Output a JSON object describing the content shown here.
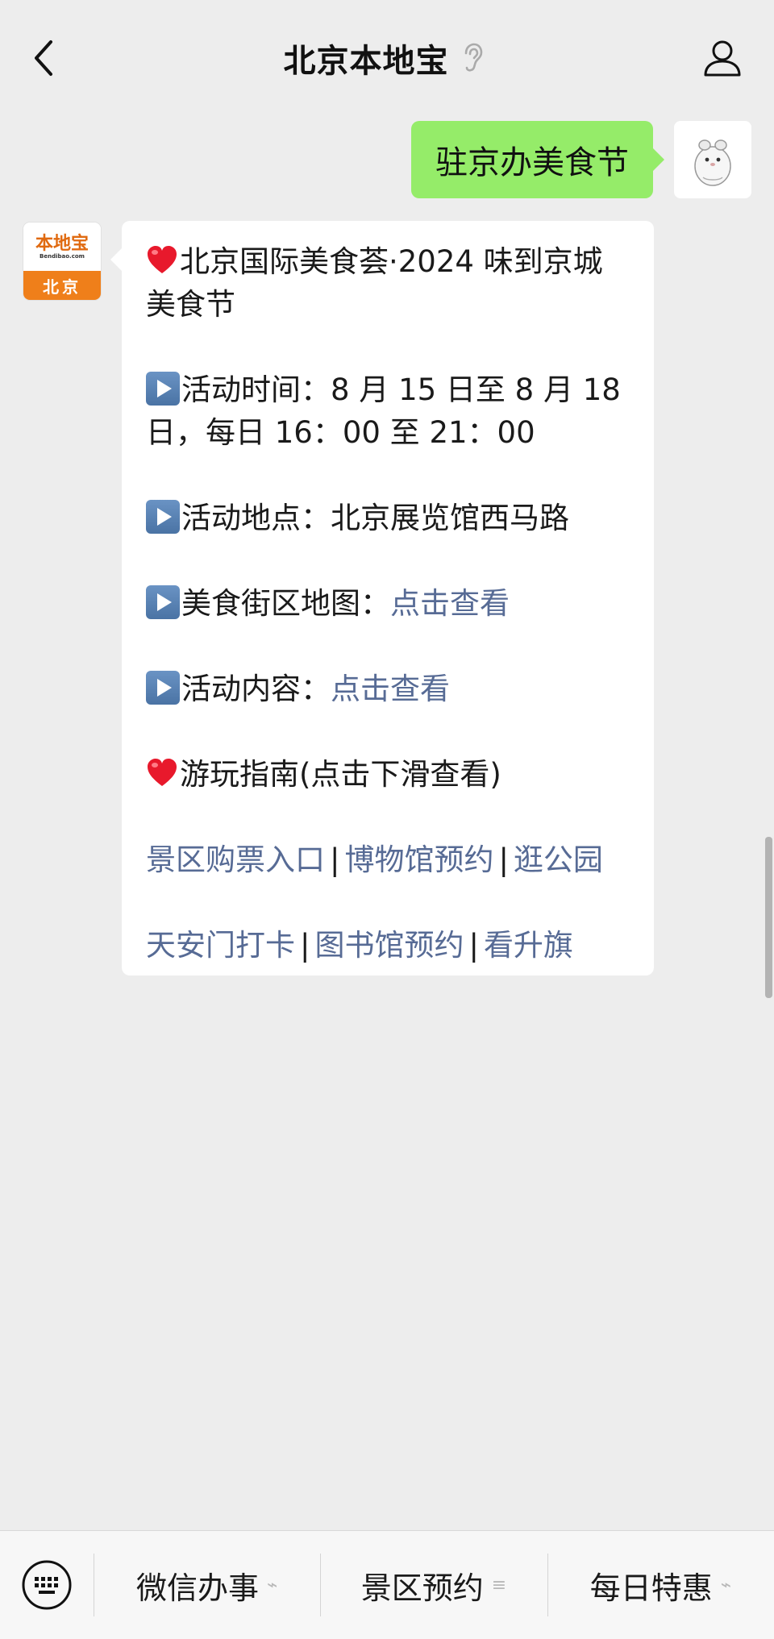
{
  "header": {
    "title": "北京本地宝",
    "back_icon": "chevron-left-icon",
    "ear_icon": "ear-icon",
    "profile_icon": "person-icon"
  },
  "outgoing_message": {
    "text": "驻京办美食节",
    "bubble_color": "#95ec69"
  },
  "account_avatar": {
    "logo_text": "本地宝",
    "logo_subtext": "Bendibao.com",
    "city": "北京"
  },
  "incoming_message": {
    "title": "北京国际美食荟·2024 味到京城美食节",
    "time_label": "活动时间：",
    "time_value": "8 月 15 日至 8 月 18 日，每日 16：00 至 21：00",
    "place_label": "活动地点：",
    "place_value": "北京展览馆西马路",
    "map_label": "美食街区地图：",
    "map_link": "点击查看",
    "content_label": "活动内容：",
    "content_link": "点击查看",
    "guide_title": "游玩指南(点击下滑查看)",
    "links_row1": [
      "景区购票入口",
      "博物馆预约",
      "逛公园"
    ],
    "links_row2": [
      "天安门打卡",
      "图书馆预约",
      "看升旗"
    ],
    "separator": "|",
    "link_color": "#576b95"
  },
  "bottom_menu": {
    "keyboard_icon": "keyboard-icon",
    "items": [
      {
        "label": "微信办事",
        "suffix_icon": "link-icon",
        "suffix": "⌁"
      },
      {
        "label": "景区预约",
        "suffix_icon": "menu-lines-icon",
        "suffix": "≡"
      },
      {
        "label": "每日特惠",
        "suffix_icon": "link-icon",
        "suffix": "⌁"
      }
    ]
  }
}
